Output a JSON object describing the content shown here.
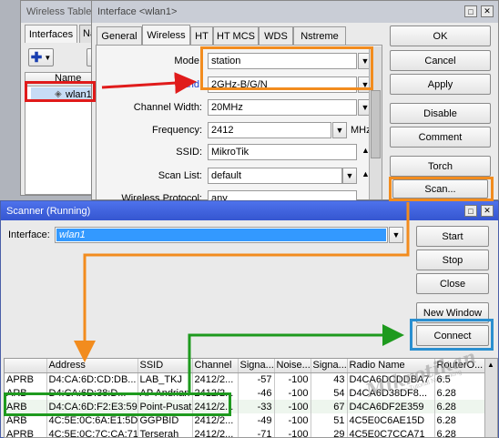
{
  "wireless_tables": {
    "title": "Wireless Tables",
    "tabs": [
      "Interfaces",
      "Na"
    ],
    "column_name": "Name",
    "row_name": "wlan1"
  },
  "interface_window": {
    "title": "Interface <wlan1>",
    "tabs": [
      "General",
      "Wireless",
      "HT",
      "HT MCS",
      "WDS",
      "Nstreme"
    ],
    "fields": {
      "mode_label": "Mode:",
      "mode_value": "station",
      "band_label": "Band:",
      "band_value": "2GHz-B/G/N",
      "channel_width_label": "Channel Width:",
      "channel_width_value": "20MHz",
      "frequency_label": "Frequency:",
      "frequency_value": "2412",
      "frequency_unit": "MHz",
      "ssid_label": "SSID:",
      "ssid_value": "MikroTik",
      "scan_list_label": "Scan List:",
      "scan_list_value": "default",
      "wireless_protocol_label": "Wireless Protocol:",
      "wireless_protocol_value": "any"
    },
    "buttons": {
      "ok": "OK",
      "cancel": "Cancel",
      "apply": "Apply",
      "disable": "Disable",
      "comment": "Comment",
      "torch": "Torch",
      "scan": "Scan..."
    }
  },
  "scanner_window": {
    "title": "Scanner (Running)",
    "interface_label": "Interface:",
    "interface_value": "wlan1",
    "buttons": {
      "start": "Start",
      "stop": "Stop",
      "close": "Close",
      "new_window": "New Window",
      "connect": "Connect"
    },
    "columns": [
      "",
      "Address",
      "SSID",
      "Channel",
      "Signa...",
      "Noise...",
      "Signa...",
      "Radio Name",
      "RouterO..."
    ],
    "rows": [
      [
        "APRB",
        "D4:CA:6D:CD:DB...",
        "LAB_TKJ",
        "2412/2...",
        "-57",
        "-100",
        "43",
        "D4CA6DCDDBA7",
        "6.5"
      ],
      [
        "ARB",
        "D4:CA:6D:38:D...",
        "AP Andrian",
        "2412/2...",
        "-46",
        "-100",
        "54",
        "D4CA6D38DF8...",
        "6.28"
      ],
      [
        "ARB",
        "D4:CA:6D:F2:E3:59",
        "Point-Pusat",
        "2412/2...",
        "-33",
        "-100",
        "67",
        "D4CA6DF2E359",
        "6.28"
      ],
      [
        "ARB",
        "4C:5E:0C:6A:E1:5D",
        "GGPBID",
        "2412/2...",
        "-49",
        "-100",
        "51",
        "4C5E0C6AE15D",
        "6.28"
      ],
      [
        "APRB",
        "4C:5E:0C:7C:CA:71",
        "Terserah",
        "2412/2...",
        "-71",
        "-100",
        "29",
        "4C5E0C7CCA71",
        "6.28"
      ]
    ]
  },
  "watermark": {
    "line1": "Mikrotikan",
    "line2": "Blog Tutorial Networking"
  },
  "colors": {
    "highlight_orange": "#f28c1e",
    "highlight_red": "#e01b1b",
    "highlight_green": "#1e9a1e",
    "highlight_blue": "#2a8fd0",
    "title_active": "#3c5fd9",
    "title_inactive": "#c9cdd6"
  }
}
